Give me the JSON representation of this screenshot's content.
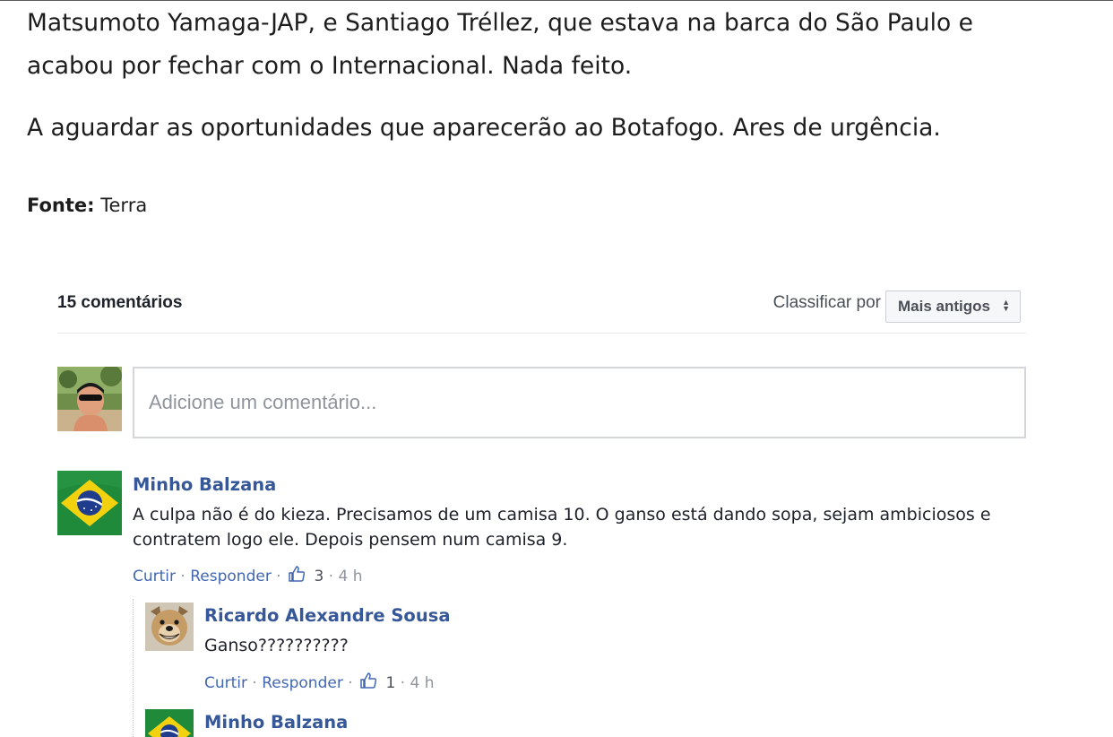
{
  "article": {
    "paragraph1_line1": "Matsumoto Yamaga-JAP, e Santiago Tréllez, que estava na barca do São Paulo e",
    "paragraph1_line2": "acabou por fechar com o Internacional. Nada feito.",
    "paragraph2": "A aguardar as oportunidades que aparecerão ao Botafogo. Ares de urgência.",
    "source_label": "Fonte:",
    "source_value": "Terra"
  },
  "comments_plugin": {
    "count_label": "15 comentários",
    "sort_label": "Classificar por",
    "sort_selected": "Mais antigos",
    "input_placeholder": "Adicione um comentário...",
    "comments": [
      {
        "author": "Minho Balzana",
        "text": "A culpa não é do kieza. Precisamos de um camisa 10. O ganso está dando sopa, sejam ambiciosos e contratem logo ele. Depois pensem num camisa 9.",
        "like_label": "Curtir",
        "reply_label": "Responder",
        "likes": "3",
        "time": "4 h",
        "avatar_icon": "brazil-flag-avatar",
        "replies": [
          {
            "author": "Ricardo Alexandre Sousa",
            "text": "Ganso??????????",
            "like_label": "Curtir",
            "reply_label": "Responder",
            "likes": "1",
            "time": "4 h",
            "avatar_icon": "smiling-dog-avatar"
          },
          {
            "author": "Minho Balzana",
            "avatar_icon": "brazil-flag-avatar"
          }
        ]
      }
    ]
  },
  "colors": {
    "link": "#4267b2",
    "author": "#365899",
    "muted": "#90949c",
    "divider": "#e5e6e9"
  },
  "separator": "·"
}
